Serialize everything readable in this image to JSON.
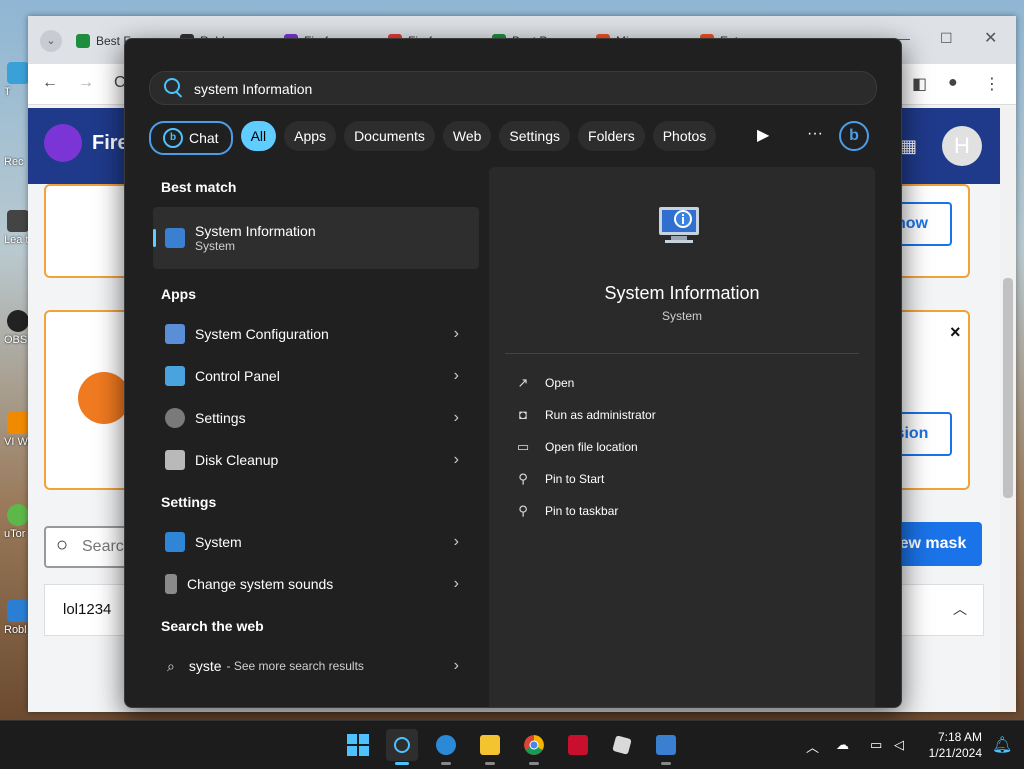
{
  "browser": {
    "tabs": [
      {
        "label": "Best F",
        "color": "#1e8e3e"
      },
      {
        "label": "Robl",
        "color": "#333333"
      },
      {
        "label": "Firef",
        "color": "#7b35d6"
      },
      {
        "label": "Firef",
        "color": "#e53935"
      },
      {
        "label": "Best P",
        "color": "#1e8e3e"
      },
      {
        "label": "Micr",
        "color": "#f25022"
      },
      {
        "label": "Enter",
        "color": "#f25022"
      }
    ],
    "site_title": "Fire",
    "avatar_letter": "H",
    "card_button_1": "now",
    "card_button_2": "sion",
    "card_close": "×",
    "search_placeholder": "Search",
    "new_mask": "ew mask",
    "list_item": "lol1234"
  },
  "desktop_icons": [
    "T",
    "Rec",
    "Lea this",
    "OBS",
    "VI Wo",
    "uTor",
    "Robl"
  ],
  "start_menu": {
    "search_value": "system Information",
    "filters": {
      "chat": "Chat",
      "all": "All",
      "apps": "Apps",
      "documents": "Documents",
      "web": "Web",
      "settings": "Settings",
      "folders": "Folders",
      "photos": "Photos"
    },
    "sections": {
      "best_match": "Best match",
      "apps": "Apps",
      "settings": "Settings",
      "search_web": "Search the web"
    },
    "best_match": {
      "title": "System Information",
      "subtitle": "System"
    },
    "apps": [
      {
        "label": "System Configuration"
      },
      {
        "label": "Control Panel"
      },
      {
        "label": "Settings"
      },
      {
        "label": "Disk Cleanup"
      }
    ],
    "settings_items": [
      {
        "label": "System"
      },
      {
        "label": "Change system sounds"
      }
    ],
    "web": {
      "query": "syste",
      "suffix": "- See more search results"
    },
    "preview": {
      "title": "System Information",
      "subtitle": "System",
      "actions": [
        "Open",
        "Run as administrator",
        "Open file location",
        "Pin to Start",
        "Pin to taskbar"
      ]
    }
  },
  "taskbar": {
    "time": "7:18 AM",
    "date": "1/21/2024"
  }
}
